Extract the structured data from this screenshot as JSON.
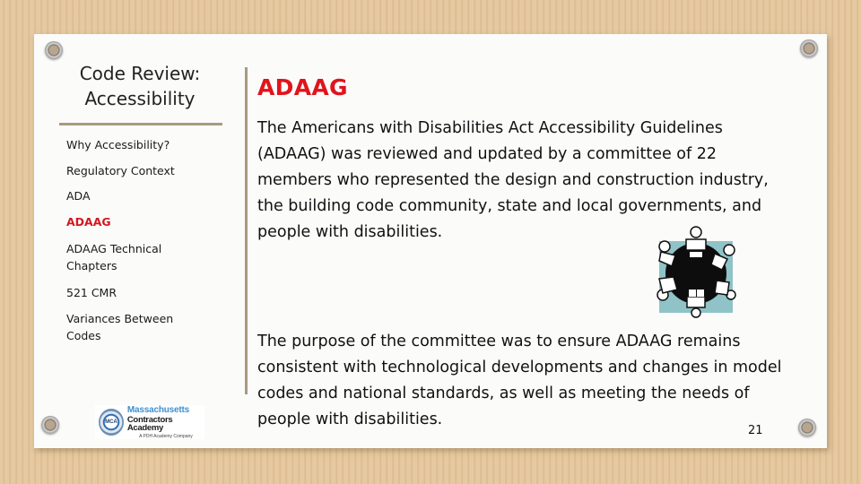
{
  "sidebar": {
    "title_line1": "Code Review:",
    "title_line2": "Accessibility",
    "items": [
      {
        "label": "Why Accessibility?",
        "active": false
      },
      {
        "label": "Regulatory Context",
        "active": false
      },
      {
        "label": "ADA",
        "active": false
      },
      {
        "label": "ADAAG",
        "active": true
      },
      {
        "label": "ADAAG Technical Chapters",
        "active": false
      },
      {
        "label": "521 CMR",
        "active": false
      },
      {
        "label": "Variances Between Codes",
        "active": false
      }
    ],
    "logo": {
      "badge": "MCA",
      "line1": "Massachusetts",
      "line2": "Contractors Academy",
      "line3": "A PDH Academy Company"
    }
  },
  "main": {
    "title": "ADAAG",
    "paragraph1": "The Americans with Disabilities Act Accessibility Guidelines (ADAAG) was reviewed and updated by a committee of 22 members who represented the design and construction industry, the building code community, state and local governments, and people with disabilities.",
    "paragraph2": "The purpose of the committee was to ensure ADAAG remains consistent with technological developments and changes in model codes and national standards, as well as meeting the needs of people with disabilities.",
    "illustration": "committee-round-table-icon"
  },
  "page_number": "21",
  "colors": {
    "accent_red": "#e0141c",
    "divider": "#a99a80",
    "card": "#fbfbfa",
    "background": "#e4c69c"
  }
}
